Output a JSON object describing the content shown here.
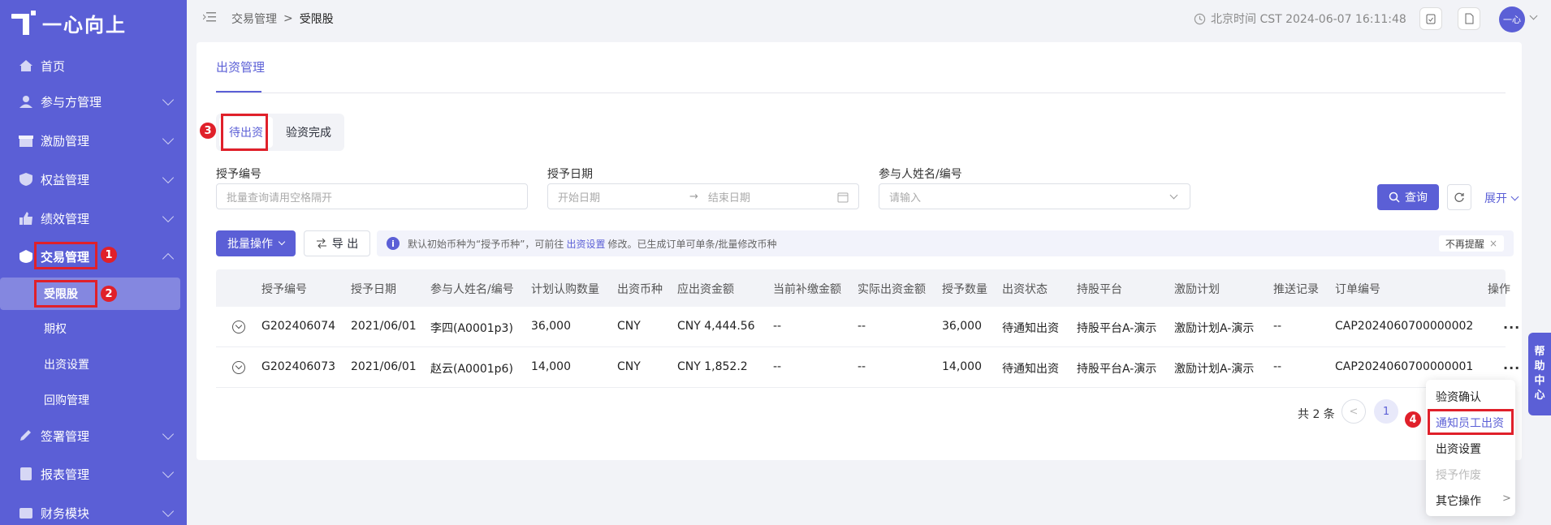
{
  "brand": {
    "logo_text": "一心向上"
  },
  "sidebar": {
    "items": [
      {
        "label": "首页"
      },
      {
        "label": "参与方管理"
      },
      {
        "label": "激励管理"
      },
      {
        "label": "权益管理"
      },
      {
        "label": "绩效管理"
      },
      {
        "label": "交易管理"
      },
      {
        "label": "签署管理"
      },
      {
        "label": "报表管理"
      },
      {
        "label": "财务模块"
      }
    ],
    "sub_items": [
      {
        "label": "受限股"
      },
      {
        "label": "期权"
      },
      {
        "label": "出资设置"
      },
      {
        "label": "回购管理"
      }
    ]
  },
  "header": {
    "breadcrumb": [
      "交易管理",
      ">",
      "受限股"
    ],
    "clock": "北京时间 CST 2024-06-07 16:11:48",
    "avatar": "一心"
  },
  "page": {
    "tab": "出资管理",
    "segments": [
      "待出资",
      "验资完成"
    ]
  },
  "filters": {
    "grant_no": {
      "label": "授予编号",
      "placeholder": "批量查询请用空格隔开"
    },
    "grant_date": {
      "label": "授予日期",
      "start": "开始日期",
      "arrow": "→",
      "end": "结束日期"
    },
    "participant": {
      "label": "参与人姓名/编号",
      "placeholder": "请输入"
    },
    "search_label": "查询",
    "expand_label": "展开"
  },
  "toolbar": {
    "batch_label": "批量操作",
    "export_label": "导 出"
  },
  "notice": {
    "text_before": "默认初始币种为“授予币种”，可前往",
    "link": "出资设置",
    "text_after": "修改。已生成订单可单条/批量修改币种",
    "dismiss": "不再提醒"
  },
  "table": {
    "columns": [
      "授予编号",
      "授予日期",
      "参与人姓名/编号",
      "计划认购数量",
      "出资币种",
      "应出资金额",
      "当前补缴金额",
      "实际出资金额",
      "授予数量",
      "出资状态",
      "持股平台",
      "激励计划",
      "推送记录",
      "订单编号",
      "操作"
    ],
    "rows": [
      [
        "G202406074",
        "2021/06/01",
        "李四(A0001p3)",
        "36,000",
        "CNY",
        "CNY 4,444.56",
        "--",
        "--",
        "36,000",
        "待通知出资",
        "持股平台A-演示",
        "激励计划A-演示",
        "--",
        "CAP2024060700000002"
      ],
      [
        "G202406073",
        "2021/06/01",
        "赵云(A0001p6)",
        "14,000",
        "CNY",
        "CNY 1,852.2",
        "--",
        "--",
        "14,000",
        "待通知出资",
        "持股平台A-演示",
        "激励计划A-演示",
        "--",
        "CAP2024060700000001"
      ]
    ],
    "more": "···"
  },
  "pagination": {
    "total": "共 2 条",
    "prev": "<",
    "page": "1"
  },
  "row_menu": {
    "items": [
      {
        "label": "验资确认"
      },
      {
        "label": "通知员工出资"
      },
      {
        "label": "出资设置"
      },
      {
        "label": "授予作废"
      },
      {
        "label": "其它操作"
      }
    ],
    "submenu_arrow": ">"
  },
  "help": {
    "chars": [
      "帮",
      "助",
      "中",
      "心"
    ]
  },
  "annotations": [
    "1",
    "2",
    "3",
    "4"
  ]
}
